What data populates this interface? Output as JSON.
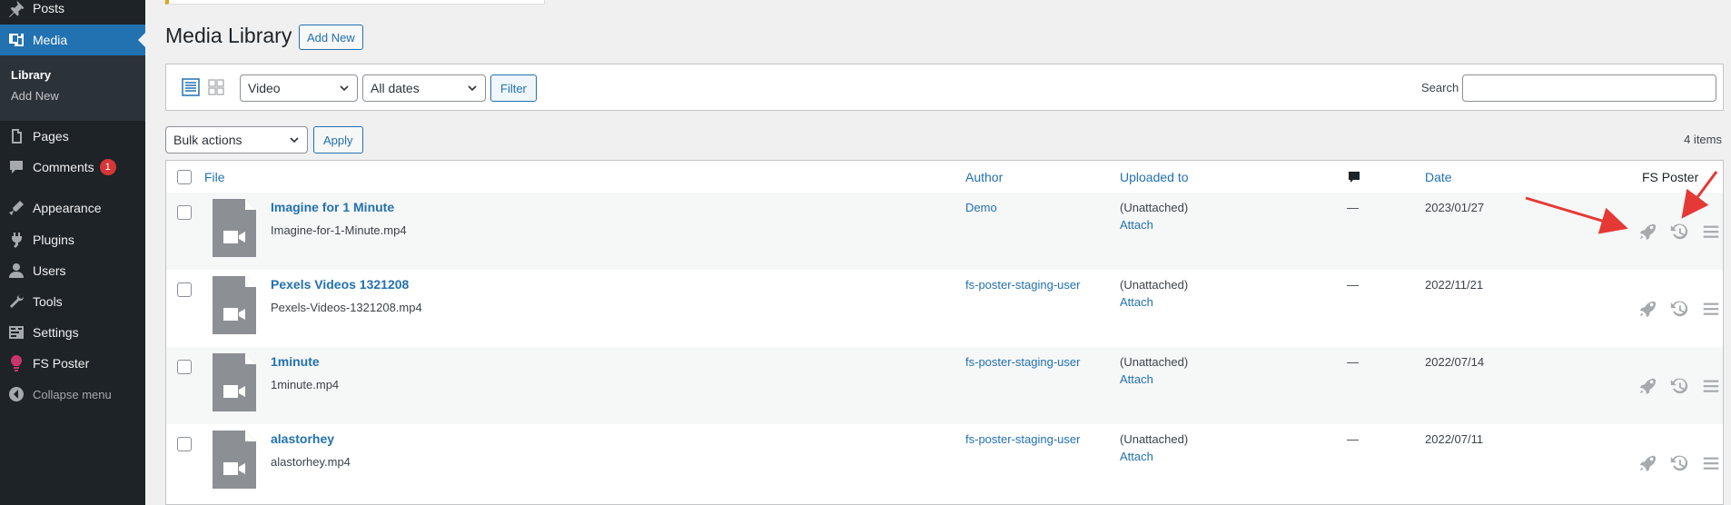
{
  "sidebar": {
    "posts": "Posts",
    "media": "Media",
    "library": "Library",
    "add_new": "Add New",
    "pages": "Pages",
    "comments": "Comments",
    "comments_count": "1",
    "appearance": "Appearance",
    "plugins": "Plugins",
    "users": "Users",
    "tools": "Tools",
    "settings": "Settings",
    "fs_poster": "FS Poster",
    "collapse": "Collapse menu"
  },
  "header": {
    "title": "Media Library",
    "add_new": "Add New"
  },
  "filters": {
    "type_selected": "Video",
    "date_selected": "All dates",
    "filter_label": "Filter",
    "search_label": "Search",
    "search_value": ""
  },
  "bulk": {
    "selected": "Bulk actions",
    "apply_label": "Apply",
    "items_count": "4 items"
  },
  "table": {
    "headers": {
      "file": "File",
      "author": "Author",
      "uploaded_to": "Uploaded to",
      "date": "Date",
      "fs_poster": "FS Poster"
    },
    "rows": [
      {
        "title": "Imagine for 1 Minute",
        "filename": "Imagine-for-1-Minute.mp4",
        "author": "Demo",
        "uploaded": "(Unattached)",
        "attach": "Attach",
        "comments": "—",
        "date": "2023/01/27"
      },
      {
        "title": "Pexels Videos 1321208",
        "filename": "Pexels-Videos-1321208.mp4",
        "author": "fs-poster-staging-user",
        "uploaded": "(Unattached)",
        "attach": "Attach",
        "comments": "—",
        "date": "2022/11/21"
      },
      {
        "title": "1minute",
        "filename": "1minute.mp4",
        "author": "fs-poster-staging-user",
        "uploaded": "(Unattached)",
        "attach": "Attach",
        "comments": "—",
        "date": "2022/07/14"
      },
      {
        "title": "alastorhey",
        "filename": "alastorhey.mp4",
        "author": "fs-poster-staging-user",
        "uploaded": "(Unattached)",
        "attach": "Attach",
        "comments": "—",
        "date": "2022/07/11"
      }
    ]
  },
  "colors": {
    "accent": "#2271b1",
    "sidebar_bg": "#1d2327",
    "annotation_arrow": "#e53935"
  },
  "icons": [
    "pushpin-icon",
    "media-icon",
    "pages-icon",
    "comments-icon",
    "appearance-icon",
    "plugins-icon",
    "users-icon",
    "tools-icon",
    "settings-icon",
    "fs-poster-icon",
    "collapse-icon",
    "list-view-icon",
    "grid-view-icon",
    "video-file-icon",
    "rocket-icon",
    "history-icon",
    "menu-icon",
    "comment-bubble-icon"
  ]
}
